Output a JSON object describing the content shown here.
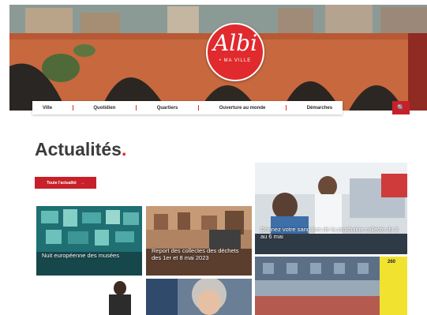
{
  "logo": {
    "word": "Albi",
    "tagline": "• MA VILLE"
  },
  "nav": {
    "items": [
      "Ville",
      "Quotidien",
      "Quartiers",
      "Ouverture au monde",
      "Démarches"
    ]
  },
  "search": {
    "icon": "search-icon",
    "glyph": "🔍"
  },
  "news": {
    "title": "Actualités",
    "title_dot": ".",
    "cta_label": "Toute l'actualité",
    "cta_arrow": "→",
    "cards": [
      {
        "caption": "Nuit européenne des musées"
      },
      {
        "caption": "Report des collectes des déchets des 1er et 8 mai 2023"
      },
      {
        "caption": "Donnez votre sang lors de la prochaine collecte du 2 au 6 mai"
      },
      {
        "caption": ""
      },
      {
        "caption": ""
      },
      {
        "caption": "",
        "badge": "260"
      }
    ]
  },
  "colors": {
    "brand_red": "#e02a2e",
    "dark_red": "#c8202a",
    "text_dark": "#3b3b3b"
  }
}
